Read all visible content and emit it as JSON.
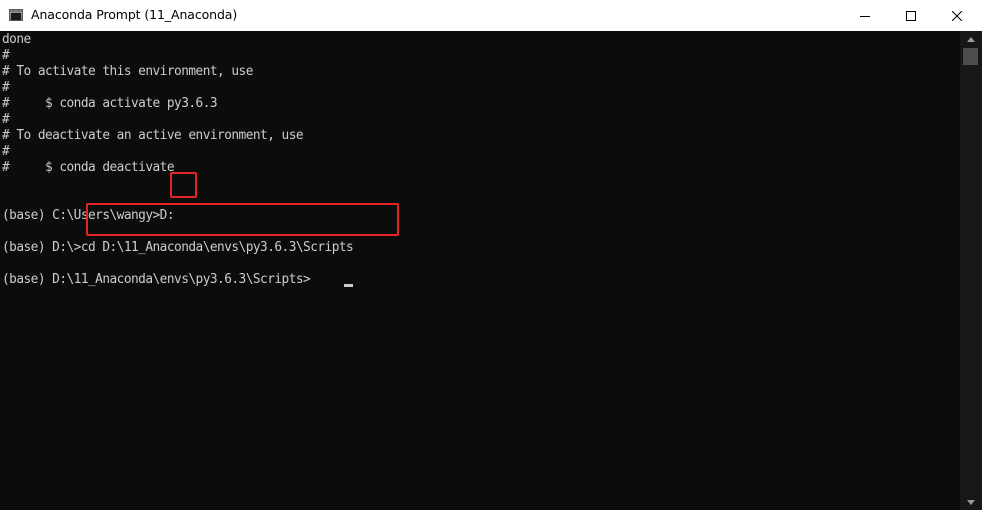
{
  "window": {
    "title": "Anaconda Prompt (11_Anaconda)"
  },
  "titlebar_buttons": {
    "minimize_icon": "minimize-icon",
    "maximize_icon": "maximize-icon",
    "close_icon": "close-icon"
  },
  "console": {
    "lines": [
      "done",
      "#",
      "# To activate this environment, use",
      "#",
      "#     $ conda activate py3.6.3",
      "#",
      "# To deactivate an active environment, use",
      "#",
      "#     $ conda deactivate",
      "",
      "(base) C:\\Users\\wangy>D:",
      "",
      "(base) D:\\>cd D:\\11_Anaconda\\envs\\py3.6.3\\Scripts",
      "",
      "(base) D:\\11_Anaconda\\envs\\py3.6.3\\Scripts>"
    ],
    "highlights": {
      "first": "D:",
      "second": "cd D:\\11_Anaconda\\envs\\py3.6.3\\Scripts"
    }
  },
  "colors": {
    "terminal_bg": "#0c0c0c",
    "terminal_text": "#cccccc",
    "highlight_border": "#e62222",
    "titlebar_bg": "#ffffff"
  }
}
